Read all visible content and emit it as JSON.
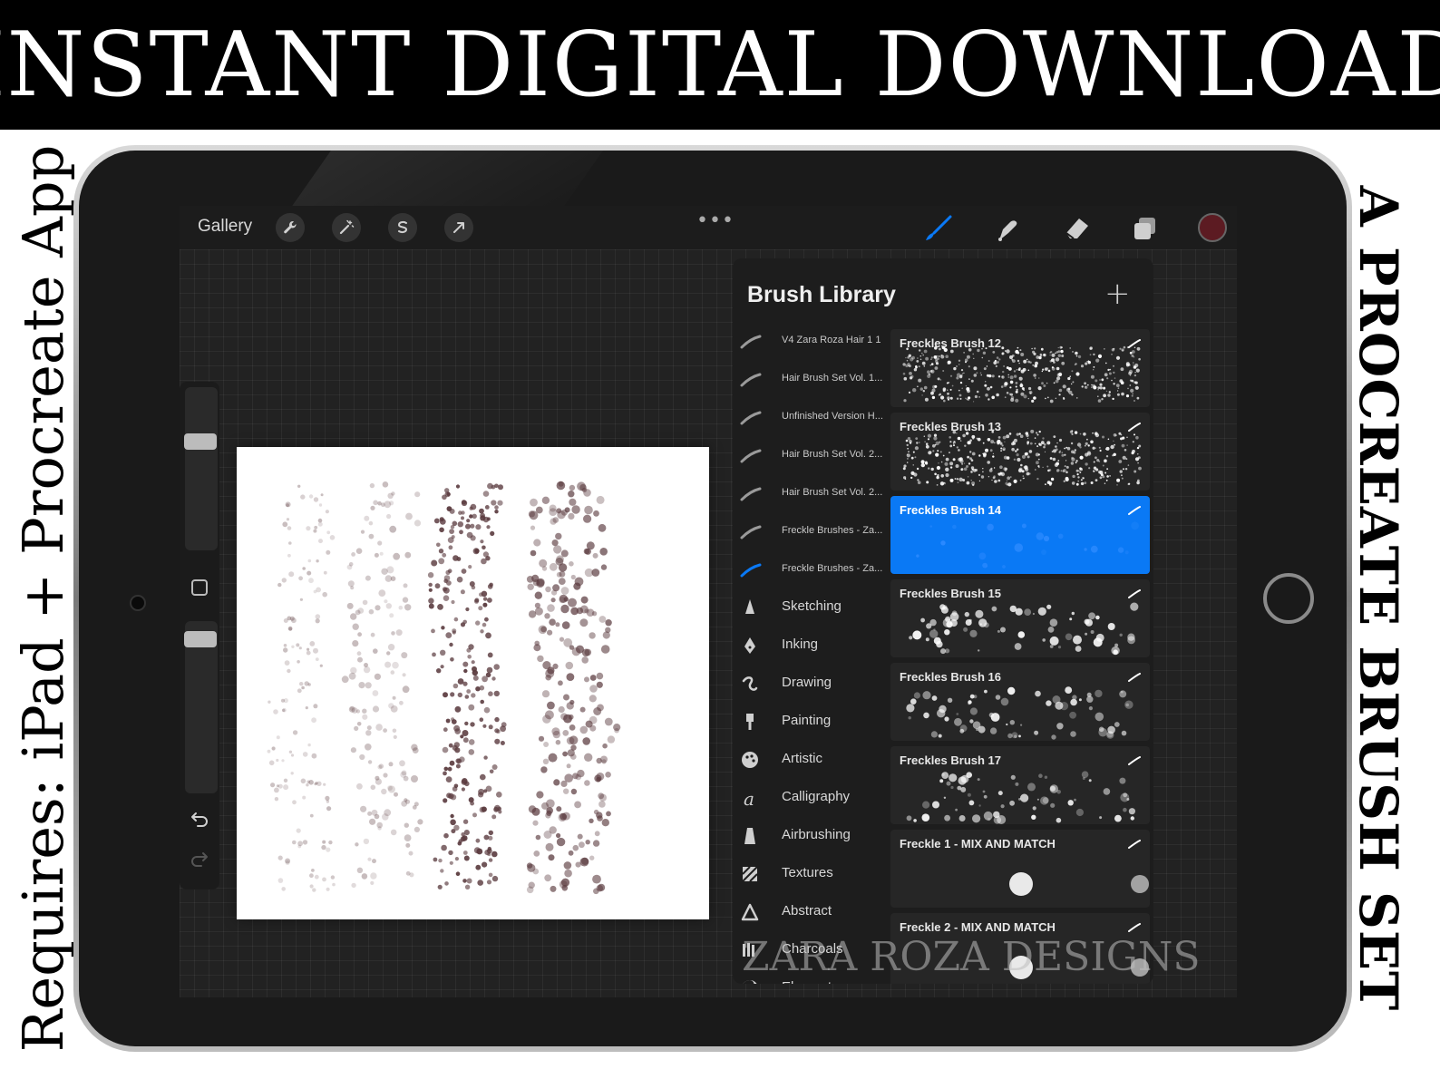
{
  "banner": {
    "title": "INSTANT DIGITAL DOWNLOAD"
  },
  "side_left": {
    "text": "Requires: iPad + Procreate App"
  },
  "side_right": {
    "text": "A PROCREATE BRUSH SET"
  },
  "topbar": {
    "gallery_label": "Gallery",
    "tools": [
      "wrench-icon",
      "magic-wand-icon",
      "selection-icon",
      "transform-arrow-icon"
    ],
    "right_tools": [
      "brush-icon",
      "smudge-icon",
      "eraser-icon",
      "layers-icon"
    ],
    "current_color": "#5c1b22",
    "more_label": "•••"
  },
  "panel": {
    "title": "Brush Library",
    "add_label": "+",
    "sets": [
      {
        "label": "V4 Zara Roza Hair 1 1",
        "icon": "stroke-icon"
      },
      {
        "label": "Hair Brush Set Vol. 1...",
        "icon": "stroke-icon"
      },
      {
        "label": "Unfinished Version H...",
        "icon": "stroke-icon"
      },
      {
        "label": "Hair Brush Set Vol. 2...",
        "icon": "stroke-icon"
      },
      {
        "label": "Hair Brush Set Vol. 2...",
        "icon": "stroke-icon"
      },
      {
        "label": "Freckle Brushes - Za...",
        "icon": "stroke-icon"
      },
      {
        "label": "Freckle Brushes - Za...",
        "icon": "stroke-icon-active"
      },
      {
        "label": "Sketching",
        "icon": "pencil-icon"
      },
      {
        "label": "Inking",
        "icon": "pen-nib-icon"
      },
      {
        "label": "Drawing",
        "icon": "squiggle-icon"
      },
      {
        "label": "Painting",
        "icon": "paint-brush-icon"
      },
      {
        "label": "Artistic",
        "icon": "palette-icon"
      },
      {
        "label": "Calligraphy",
        "icon": "calligraphy-icon"
      },
      {
        "label": "Airbrushing",
        "icon": "airbrush-icon"
      },
      {
        "label": "Textures",
        "icon": "texture-icon"
      },
      {
        "label": "Abstract",
        "icon": "triangle-icon"
      },
      {
        "label": "Charcoals",
        "icon": "charcoal-icon"
      },
      {
        "label": "Elements",
        "icon": "yin-yang-icon"
      }
    ],
    "brushes": [
      {
        "name": "Freckles Brush 12",
        "selected": false
      },
      {
        "name": "Freckles Brush 13",
        "selected": false
      },
      {
        "name": "Freckles Brush 14",
        "selected": true
      },
      {
        "name": "Freckles Brush 15",
        "selected": false
      },
      {
        "name": "Freckles Brush 16",
        "selected": false
      },
      {
        "name": "Freckles Brush 17",
        "selected": false
      },
      {
        "name": "Freckle 1 - MIX AND MATCH",
        "selected": false
      },
      {
        "name": "Freckle 2 - MIX AND MATCH",
        "selected": false
      }
    ]
  },
  "watermark": "ZARA ROZA DESIGNS",
  "colors": {
    "accent": "#0a79f5",
    "freckle": "#5a3a3e"
  }
}
